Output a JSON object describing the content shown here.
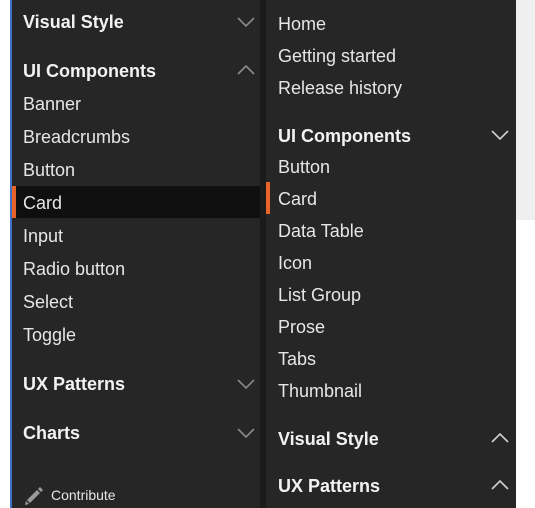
{
  "left_nav": {
    "visual_style": "Visual Style",
    "ui_components": "UI Components",
    "components": [
      "Banner",
      "Breadcrumbs",
      "Button",
      "Card",
      "Input",
      "Radio button",
      "Select",
      "Toggle"
    ],
    "selected_component": "Card",
    "ux_patterns": "UX Patterns",
    "charts": "Charts",
    "contribute": "Contribute"
  },
  "right_nav": {
    "top_links": [
      "Home",
      "Getting started",
      "Release history"
    ],
    "ui_components": "UI Components",
    "components": [
      "Button",
      "Card",
      "Data Table",
      "Icon",
      "List Group",
      "Prose",
      "Tabs",
      "Thumbnail"
    ],
    "selected_component": "Card",
    "visual_style": "Visual Style",
    "ux_patterns": "UX Patterns"
  },
  "icons": {
    "chevron_down": "chevron-down-icon",
    "chevron_up": "chevron-up-icon",
    "pencil": "pencil-icon"
  },
  "colors": {
    "panel_bg": "#262626",
    "selected_row_bg": "#0f0f0f",
    "accent": "#e8632a",
    "left_border": "#3d6fc2",
    "text": "#e6e6e6",
    "chevron": "#8a8a8a"
  }
}
